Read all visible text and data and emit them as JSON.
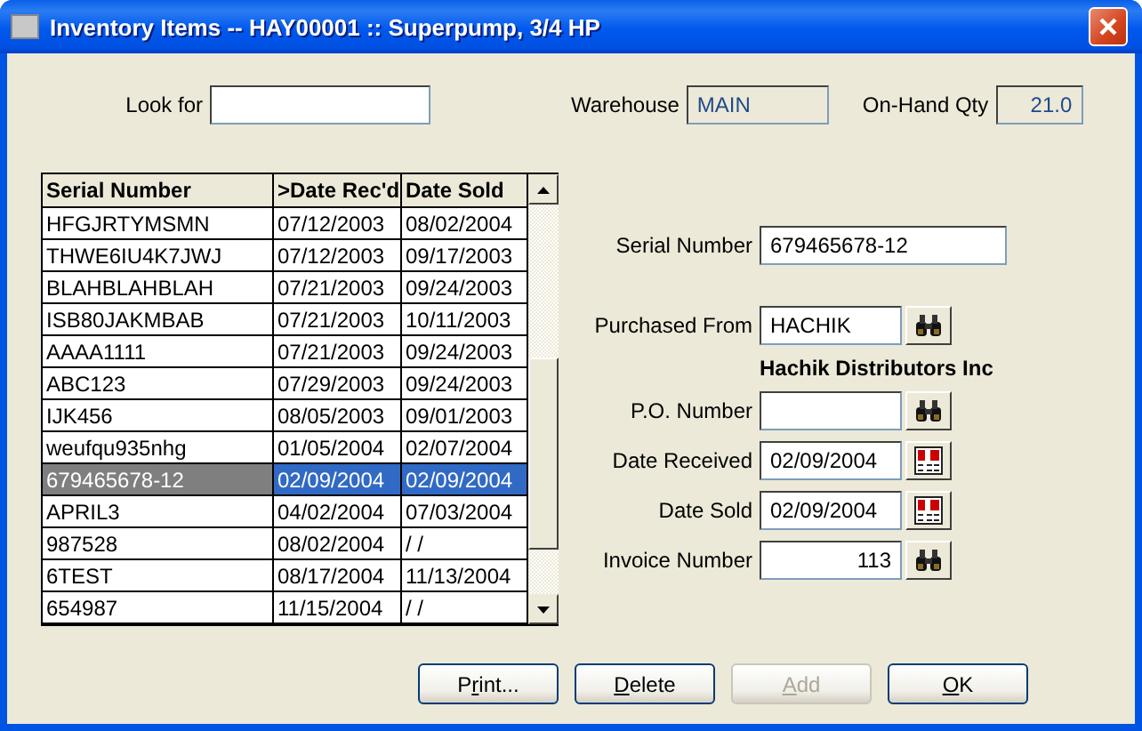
{
  "window": {
    "title": "Inventory Items -- HAY00001 :: Superpump, 3/4 HP"
  },
  "look_for": {
    "label": "Look for"
  },
  "warehouse": {
    "label": "Warehouse",
    "value": "MAIN"
  },
  "on_hand_qty": {
    "label": "On-Hand Qty",
    "value": "21.0"
  },
  "table": {
    "columns": [
      "Serial Number",
      ">Date Rec'd",
      "Date Sold"
    ],
    "rows": [
      {
        "cells": [
          "HFGJRTYMSMN",
          "07/12/2003",
          "08/02/2004"
        ],
        "selected": false
      },
      {
        "cells": [
          "THWE6IU4K7JWJ",
          "07/12/2003",
          "09/17/2003"
        ],
        "selected": false
      },
      {
        "cells": [
          "BLAHBLAHBLAH",
          "07/21/2003",
          "09/24/2003"
        ],
        "selected": false
      },
      {
        "cells": [
          "ISB80JAKMBAB",
          "07/21/2003",
          "10/11/2003"
        ],
        "selected": false
      },
      {
        "cells": [
          "AAAA1111",
          "07/21/2003",
          "09/24/2003"
        ],
        "selected": false
      },
      {
        "cells": [
          "ABC123",
          "07/29/2003",
          "09/24/2003"
        ],
        "selected": false
      },
      {
        "cells": [
          "IJK456",
          "08/05/2003",
          "09/01/2003"
        ],
        "selected": false
      },
      {
        "cells": [
          "weufqu935nhg",
          "01/05/2004",
          "02/07/2004"
        ],
        "selected": false
      },
      {
        "cells": [
          "679465678-12",
          "02/09/2004",
          "02/09/2004"
        ],
        "selected": true
      },
      {
        "cells": [
          "APRIL3",
          "04/02/2004",
          "07/03/2004"
        ],
        "selected": false
      },
      {
        "cells": [
          "987528",
          "08/02/2004",
          "/ /"
        ],
        "selected": false
      },
      {
        "cells": [
          "6TEST",
          "08/17/2004",
          "11/13/2004"
        ],
        "selected": false
      },
      {
        "cells": [
          "654987",
          "11/15/2004",
          "/ /"
        ],
        "selected": false
      }
    ]
  },
  "form": [
    {
      "kind": "text",
      "label": "Serial Number",
      "value": "679465678-12"
    },
    {
      "kind": "lookup",
      "label": "Purchased From",
      "value": "HACHIK",
      "note": "Hachik Distributors Inc"
    },
    {
      "kind": "lookup",
      "label": "P.O. Number"
    },
    {
      "kind": "date",
      "label": "Date Received",
      "value": "02/09/2004"
    },
    {
      "kind": "date",
      "label": "Date Sold",
      "value": "02/09/2004"
    },
    {
      "kind": "amount",
      "label": "Invoice Number",
      "value": "113"
    }
  ],
  "buttons": [
    {
      "before": "P",
      "key": "r",
      "after": "int...",
      "disabled": false
    },
    {
      "key": "D",
      "after": "elete",
      "disabled": false
    },
    {
      "key": "A",
      "after": "dd",
      "disabled": true
    },
    {
      "key": "O",
      "after": "K",
      "disabled": false
    }
  ]
}
